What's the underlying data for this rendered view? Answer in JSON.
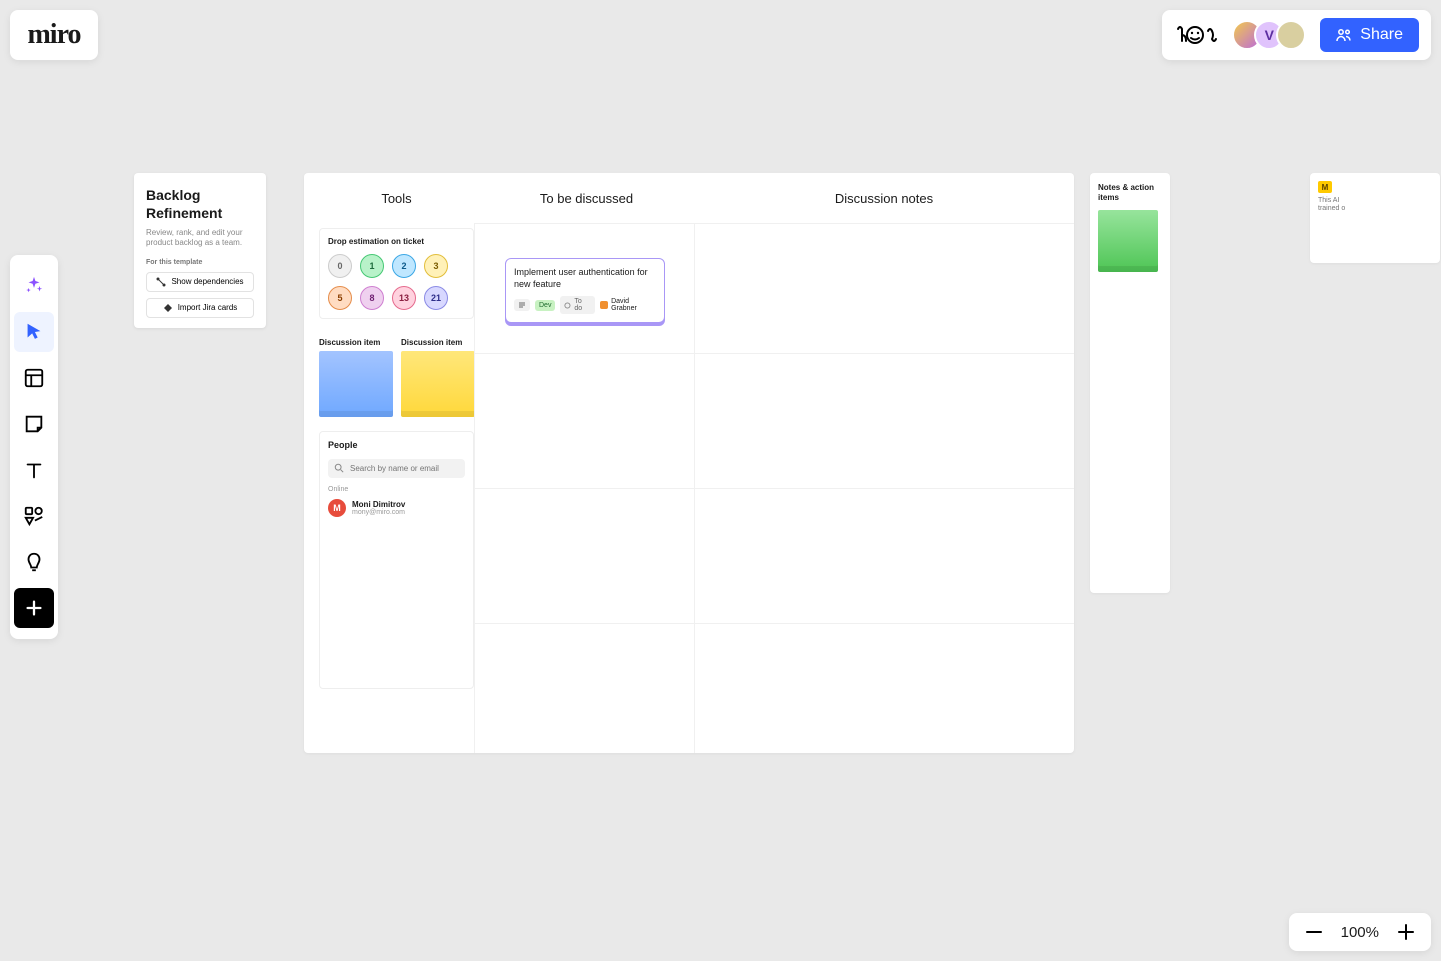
{
  "logo": {
    "text": "miro"
  },
  "header": {
    "avatars": [
      {
        "initials": "",
        "class": "av1"
      },
      {
        "initials": "V",
        "class": "av2"
      },
      {
        "initials": "",
        "class": "av3"
      }
    ],
    "share_label": "Share"
  },
  "template": {
    "title": "Backlog Refinement",
    "subtitle": "Review, rank, and edit your product backlog as a team.",
    "for_this_label": "For this template",
    "show_deps_label": "Show dependencies",
    "import_jira_label": "Import Jira cards"
  },
  "board": {
    "columns": {
      "tools": "Tools",
      "discussed": "To be discussed",
      "notes": "Discussion notes"
    },
    "tools_panel": {
      "label": "Drop estimation on ticket",
      "chips": [
        "0",
        "1",
        "2",
        "3",
        "5",
        "8",
        "13",
        "21"
      ]
    },
    "discussion_items": {
      "label1": "Discussion item",
      "label2": "Discussion item"
    },
    "people": {
      "header": "People",
      "search_placeholder": "Search by name or email",
      "online_label": "Online",
      "person": {
        "avatar_initial": "M",
        "name": "Moni Dimitrov",
        "email": "mony@miro.com"
      }
    },
    "ticket": {
      "title": "Implement user authentication for new feature",
      "tag_dev": "Dev",
      "tag_todo": "To do",
      "assignee": "David Grabner"
    }
  },
  "notes_card": {
    "header": "Notes & action items"
  },
  "right_panel": {
    "badge": "M",
    "text_line1": "This AI",
    "text_line2": "trained o"
  },
  "zoom": {
    "value": "100%"
  }
}
